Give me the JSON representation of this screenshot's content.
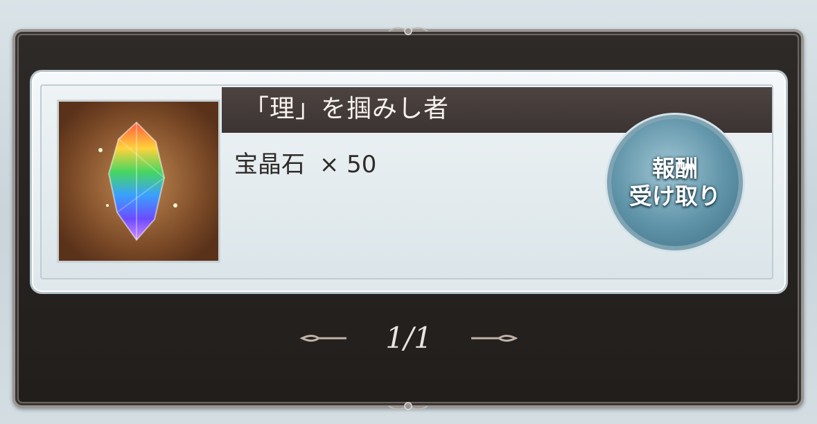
{
  "mission": {
    "title": "「理」を掴みし者",
    "reward_name": "宝晶石",
    "reward_quantity": "× 50",
    "reward_icon": "crystal-icon"
  },
  "claim_button": {
    "line1": "報酬",
    "line2": "受け取り"
  },
  "pagination": {
    "label": "1/1"
  },
  "colors": {
    "frame": "#262220",
    "title_bar": "#463d3b",
    "card": "#e8eef1",
    "button": "#5f93a8"
  }
}
